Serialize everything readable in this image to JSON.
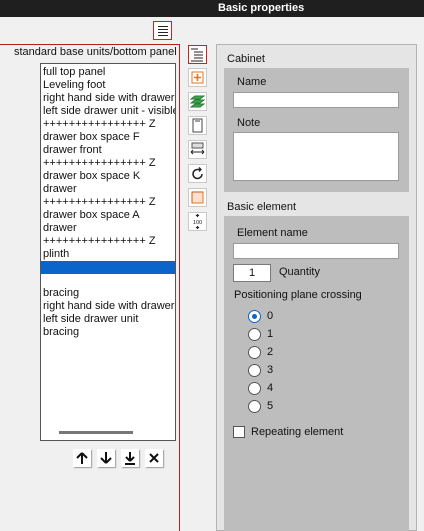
{
  "window": {
    "title": "Basic properties"
  },
  "tree": {
    "title": "standard base units/bottom panel",
    "items": [
      {
        "label": "full top panel",
        "selected": false
      },
      {
        "label": "Leveling foot",
        "selected": false
      },
      {
        "label": "right hand side with drawer -",
        "selected": false
      },
      {
        "label": "left side drawer unit - visible",
        "selected": false
      },
      {
        "label": "++++++++++++++++ Z",
        "selected": false
      },
      {
        "label": "drawer box space F",
        "selected": false
      },
      {
        "label": "drawer front",
        "selected": false
      },
      {
        "label": "++++++++++++++++ Z",
        "selected": false
      },
      {
        "label": "drawer box space K",
        "selected": false
      },
      {
        "label": "drawer",
        "selected": false
      },
      {
        "label": "++++++++++++++++ Z",
        "selected": false
      },
      {
        "label": "drawer box space A",
        "selected": false
      },
      {
        "label": "drawer",
        "selected": false
      },
      {
        "label": "++++++++++++++++ Z",
        "selected": false
      },
      {
        "label": "plinth",
        "selected": false
      },
      {
        "label": "",
        "selected": true
      },
      {
        "label": "",
        "selected": false
      },
      {
        "label": "bracing",
        "selected": false
      },
      {
        "label": "right hand side with drawer",
        "selected": false
      },
      {
        "label": "left side drawer unit",
        "selected": false
      },
      {
        "label": "bracing",
        "selected": false
      }
    ],
    "order_buttons": [
      "arrow-up-icon",
      "arrow-down-icon",
      "arrow-to-bottom-icon",
      "delete-x-icon"
    ]
  },
  "toolbar": {
    "tools": [
      "properties-list-icon",
      "add-element-icon",
      "layers-icon",
      "panel-icon",
      "width-resize-icon",
      "rotate-icon",
      "color-fill-icon",
      "scale-100-icon"
    ]
  },
  "cabinet": {
    "section_title": "Cabinet",
    "name_label": "Name",
    "name_value": "",
    "note_label": "Note",
    "note_value": ""
  },
  "element": {
    "section_title": "Basic element",
    "element_name_label": "Element name",
    "element_name_value": "",
    "quantity_value": "1",
    "quantity_label": "Quantity",
    "positioning_label": "Positioning plane crossing",
    "positioning_options": [
      "0",
      "1",
      "2",
      "3",
      "4",
      "5"
    ],
    "positioning_selected": "0",
    "repeating_label": "Repeating element",
    "repeating_checked": false
  },
  "colors": {
    "selection": "#0a64c9",
    "accent_red": "#b81e1e",
    "group_gray": "#bdbdbd"
  }
}
